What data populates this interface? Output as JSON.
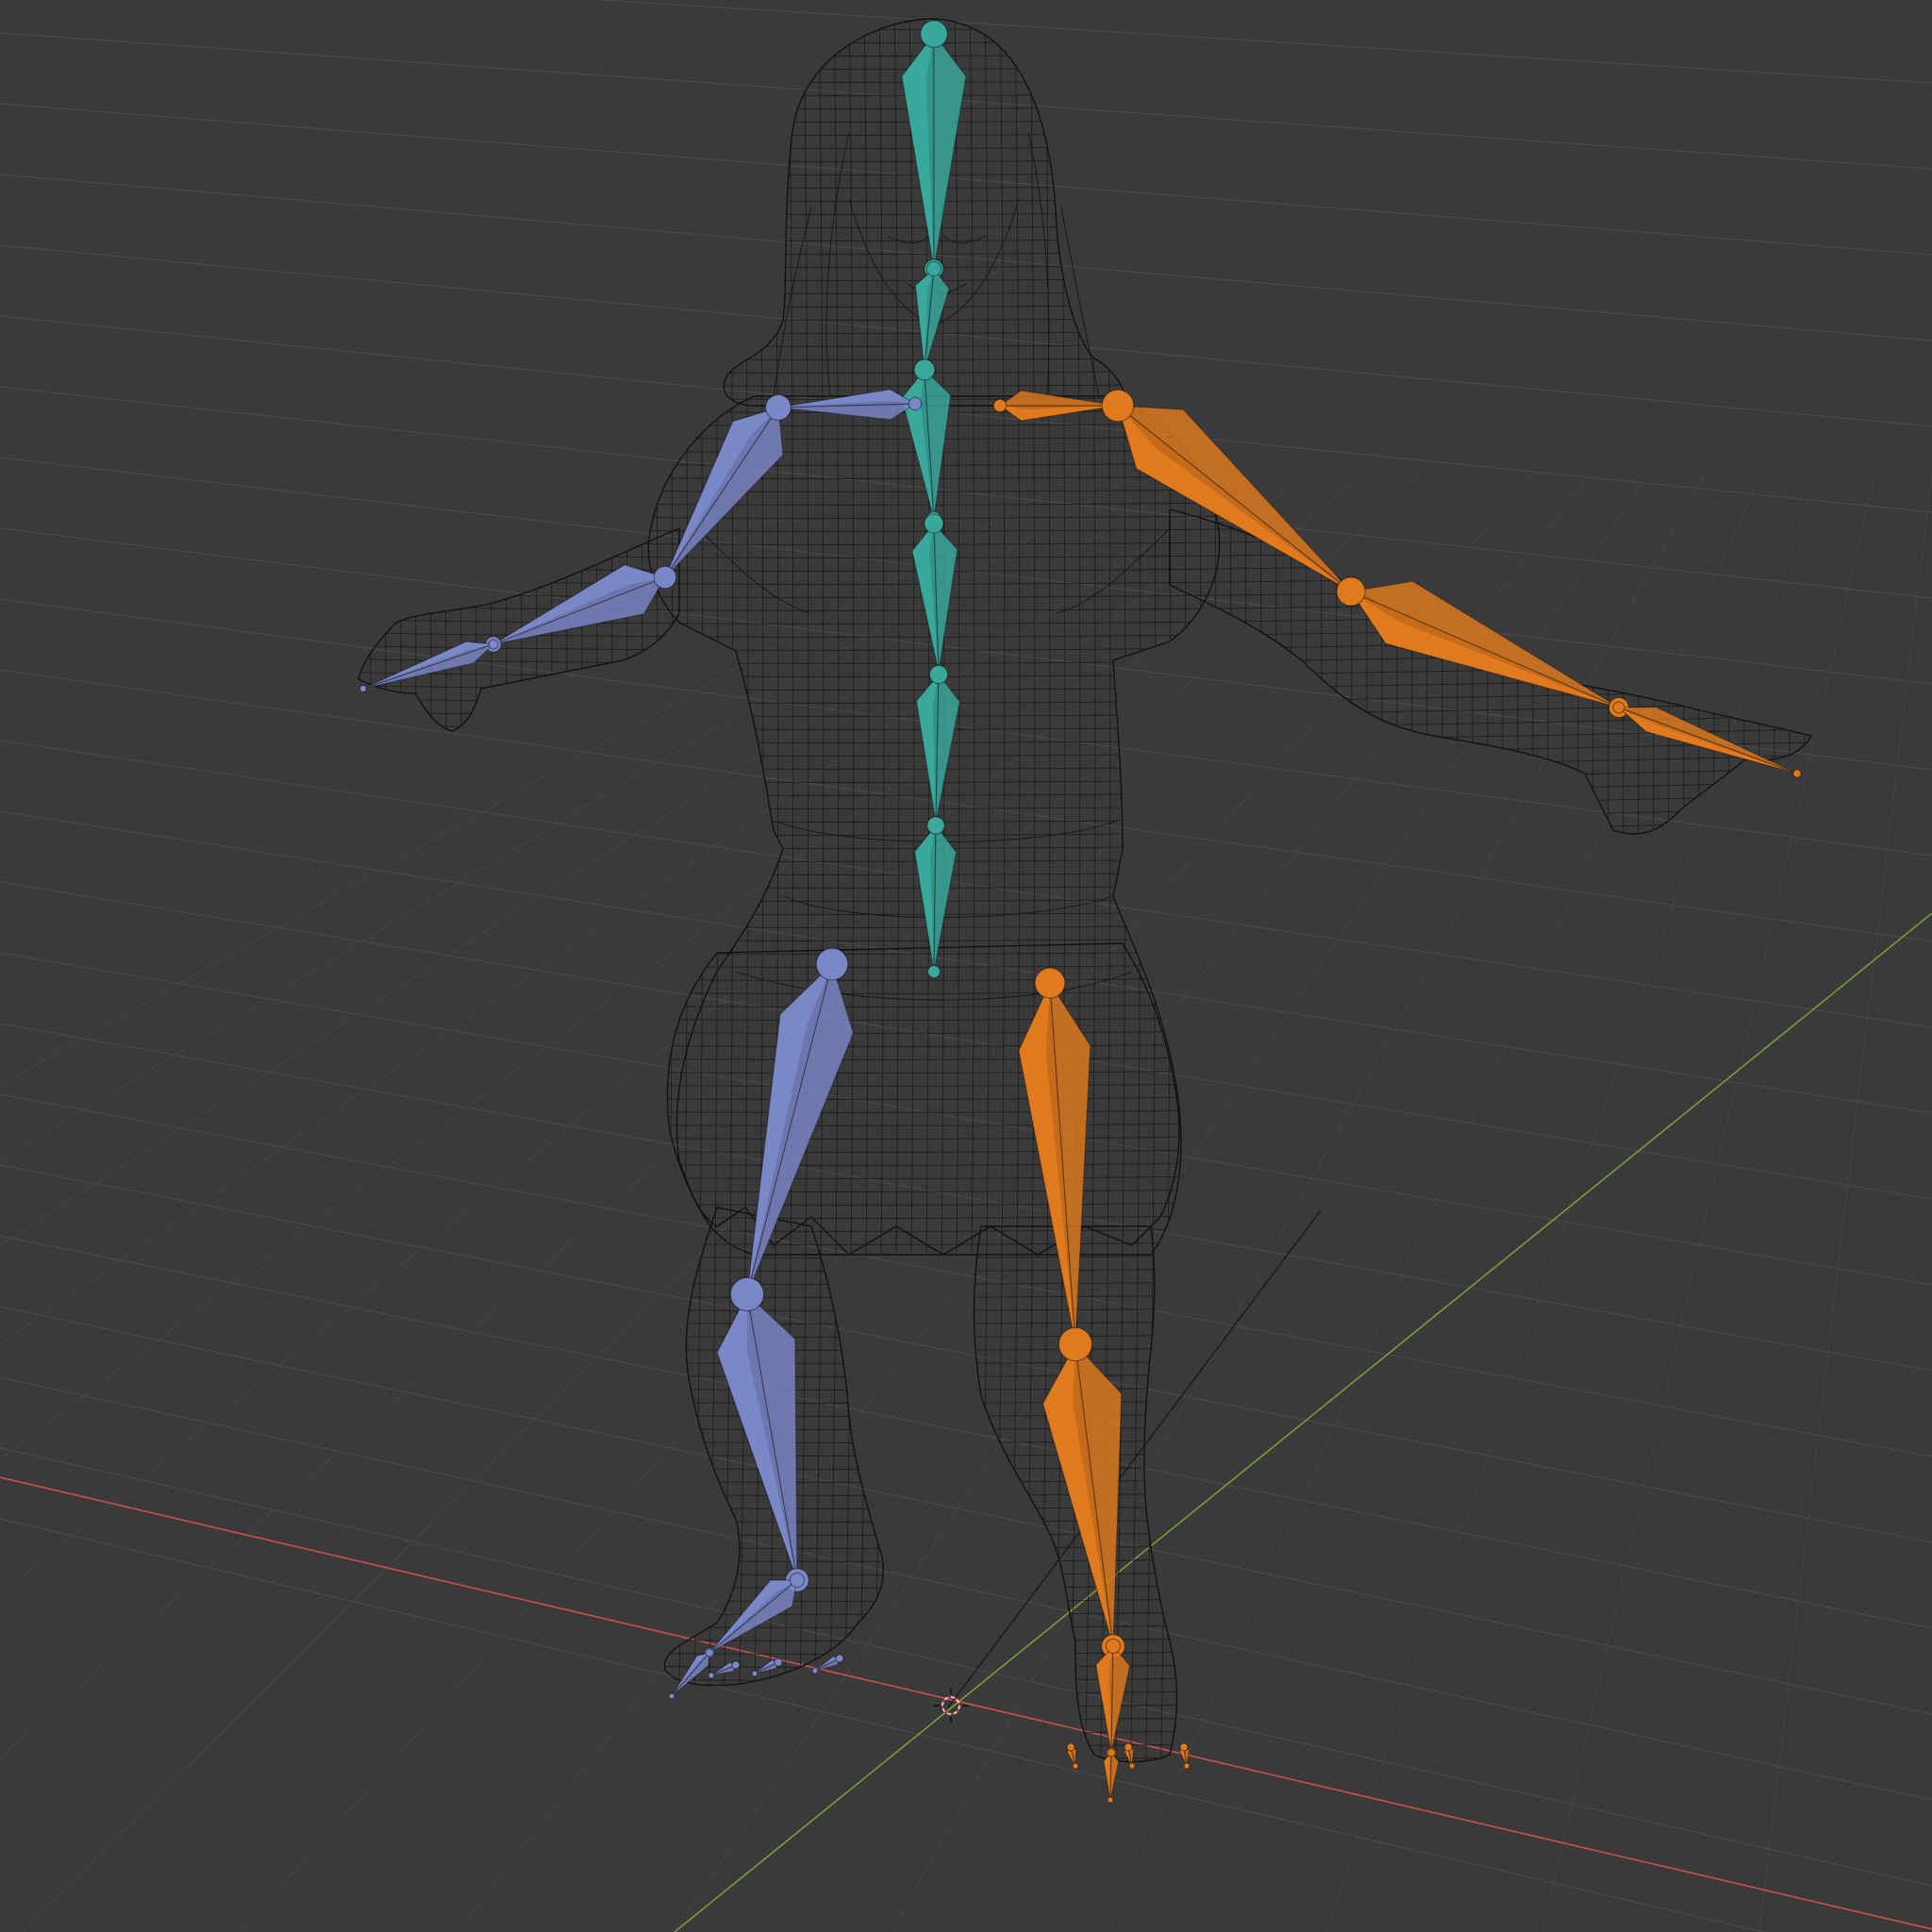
{
  "viewport": {
    "kind": "3d-viewport",
    "shading": "wireframe",
    "background_color": "#3a3a3a",
    "grid_color": "#4a4a4a",
    "x_axis_color": "#c85050",
    "y_axis_color": "#7d9a3c"
  },
  "colors": {
    "bone_center": "#3aa99c",
    "bone_left": "#7b88c8",
    "bone_right": "#e07a1f",
    "mesh_wire": "#111111"
  },
  "objects": [
    {
      "name": "character-mesh",
      "type": "mesh",
      "display": "wireframe"
    },
    {
      "name": "armature",
      "type": "armature",
      "display": "octahedral"
    },
    {
      "name": "3d-cursor",
      "type": "cursor"
    }
  ]
}
